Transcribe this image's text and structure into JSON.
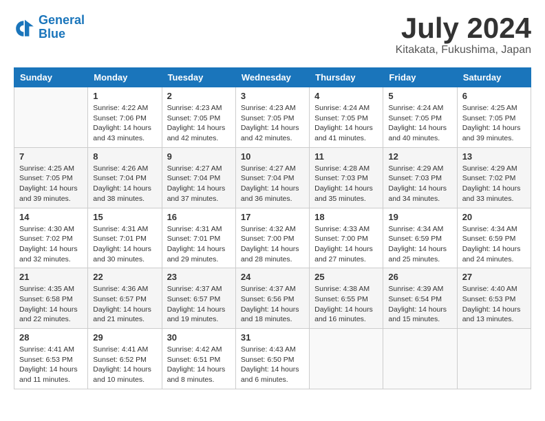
{
  "header": {
    "logo_line1": "General",
    "logo_line2": "Blue",
    "month": "July 2024",
    "location": "Kitakata, Fukushima, Japan"
  },
  "weekdays": [
    "Sunday",
    "Monday",
    "Tuesday",
    "Wednesday",
    "Thursday",
    "Friday",
    "Saturday"
  ],
  "weeks": [
    [
      {
        "day": "",
        "info": ""
      },
      {
        "day": "1",
        "info": "Sunrise: 4:22 AM\nSunset: 7:06 PM\nDaylight: 14 hours\nand 43 minutes."
      },
      {
        "day": "2",
        "info": "Sunrise: 4:23 AM\nSunset: 7:05 PM\nDaylight: 14 hours\nand 42 minutes."
      },
      {
        "day": "3",
        "info": "Sunrise: 4:23 AM\nSunset: 7:05 PM\nDaylight: 14 hours\nand 42 minutes."
      },
      {
        "day": "4",
        "info": "Sunrise: 4:24 AM\nSunset: 7:05 PM\nDaylight: 14 hours\nand 41 minutes."
      },
      {
        "day": "5",
        "info": "Sunrise: 4:24 AM\nSunset: 7:05 PM\nDaylight: 14 hours\nand 40 minutes."
      },
      {
        "day": "6",
        "info": "Sunrise: 4:25 AM\nSunset: 7:05 PM\nDaylight: 14 hours\nand 39 minutes."
      }
    ],
    [
      {
        "day": "7",
        "info": "Sunrise: 4:25 AM\nSunset: 7:05 PM\nDaylight: 14 hours\nand 39 minutes."
      },
      {
        "day": "8",
        "info": "Sunrise: 4:26 AM\nSunset: 7:04 PM\nDaylight: 14 hours\nand 38 minutes."
      },
      {
        "day": "9",
        "info": "Sunrise: 4:27 AM\nSunset: 7:04 PM\nDaylight: 14 hours\nand 37 minutes."
      },
      {
        "day": "10",
        "info": "Sunrise: 4:27 AM\nSunset: 7:04 PM\nDaylight: 14 hours\nand 36 minutes."
      },
      {
        "day": "11",
        "info": "Sunrise: 4:28 AM\nSunset: 7:03 PM\nDaylight: 14 hours\nand 35 minutes."
      },
      {
        "day": "12",
        "info": "Sunrise: 4:29 AM\nSunset: 7:03 PM\nDaylight: 14 hours\nand 34 minutes."
      },
      {
        "day": "13",
        "info": "Sunrise: 4:29 AM\nSunset: 7:02 PM\nDaylight: 14 hours\nand 33 minutes."
      }
    ],
    [
      {
        "day": "14",
        "info": "Sunrise: 4:30 AM\nSunset: 7:02 PM\nDaylight: 14 hours\nand 32 minutes."
      },
      {
        "day": "15",
        "info": "Sunrise: 4:31 AM\nSunset: 7:01 PM\nDaylight: 14 hours\nand 30 minutes."
      },
      {
        "day": "16",
        "info": "Sunrise: 4:31 AM\nSunset: 7:01 PM\nDaylight: 14 hours\nand 29 minutes."
      },
      {
        "day": "17",
        "info": "Sunrise: 4:32 AM\nSunset: 7:00 PM\nDaylight: 14 hours\nand 28 minutes."
      },
      {
        "day": "18",
        "info": "Sunrise: 4:33 AM\nSunset: 7:00 PM\nDaylight: 14 hours\nand 27 minutes."
      },
      {
        "day": "19",
        "info": "Sunrise: 4:34 AM\nSunset: 6:59 PM\nDaylight: 14 hours\nand 25 minutes."
      },
      {
        "day": "20",
        "info": "Sunrise: 4:34 AM\nSunset: 6:59 PM\nDaylight: 14 hours\nand 24 minutes."
      }
    ],
    [
      {
        "day": "21",
        "info": "Sunrise: 4:35 AM\nSunset: 6:58 PM\nDaylight: 14 hours\nand 22 minutes."
      },
      {
        "day": "22",
        "info": "Sunrise: 4:36 AM\nSunset: 6:57 PM\nDaylight: 14 hours\nand 21 minutes."
      },
      {
        "day": "23",
        "info": "Sunrise: 4:37 AM\nSunset: 6:57 PM\nDaylight: 14 hours\nand 19 minutes."
      },
      {
        "day": "24",
        "info": "Sunrise: 4:37 AM\nSunset: 6:56 PM\nDaylight: 14 hours\nand 18 minutes."
      },
      {
        "day": "25",
        "info": "Sunrise: 4:38 AM\nSunset: 6:55 PM\nDaylight: 14 hours\nand 16 minutes."
      },
      {
        "day": "26",
        "info": "Sunrise: 4:39 AM\nSunset: 6:54 PM\nDaylight: 14 hours\nand 15 minutes."
      },
      {
        "day": "27",
        "info": "Sunrise: 4:40 AM\nSunset: 6:53 PM\nDaylight: 14 hours\nand 13 minutes."
      }
    ],
    [
      {
        "day": "28",
        "info": "Sunrise: 4:41 AM\nSunset: 6:53 PM\nDaylight: 14 hours\nand 11 minutes."
      },
      {
        "day": "29",
        "info": "Sunrise: 4:41 AM\nSunset: 6:52 PM\nDaylight: 14 hours\nand 10 minutes."
      },
      {
        "day": "30",
        "info": "Sunrise: 4:42 AM\nSunset: 6:51 PM\nDaylight: 14 hours\nand 8 minutes."
      },
      {
        "day": "31",
        "info": "Sunrise: 4:43 AM\nSunset: 6:50 PM\nDaylight: 14 hours\nand 6 minutes."
      },
      {
        "day": "",
        "info": ""
      },
      {
        "day": "",
        "info": ""
      },
      {
        "day": "",
        "info": ""
      }
    ]
  ]
}
